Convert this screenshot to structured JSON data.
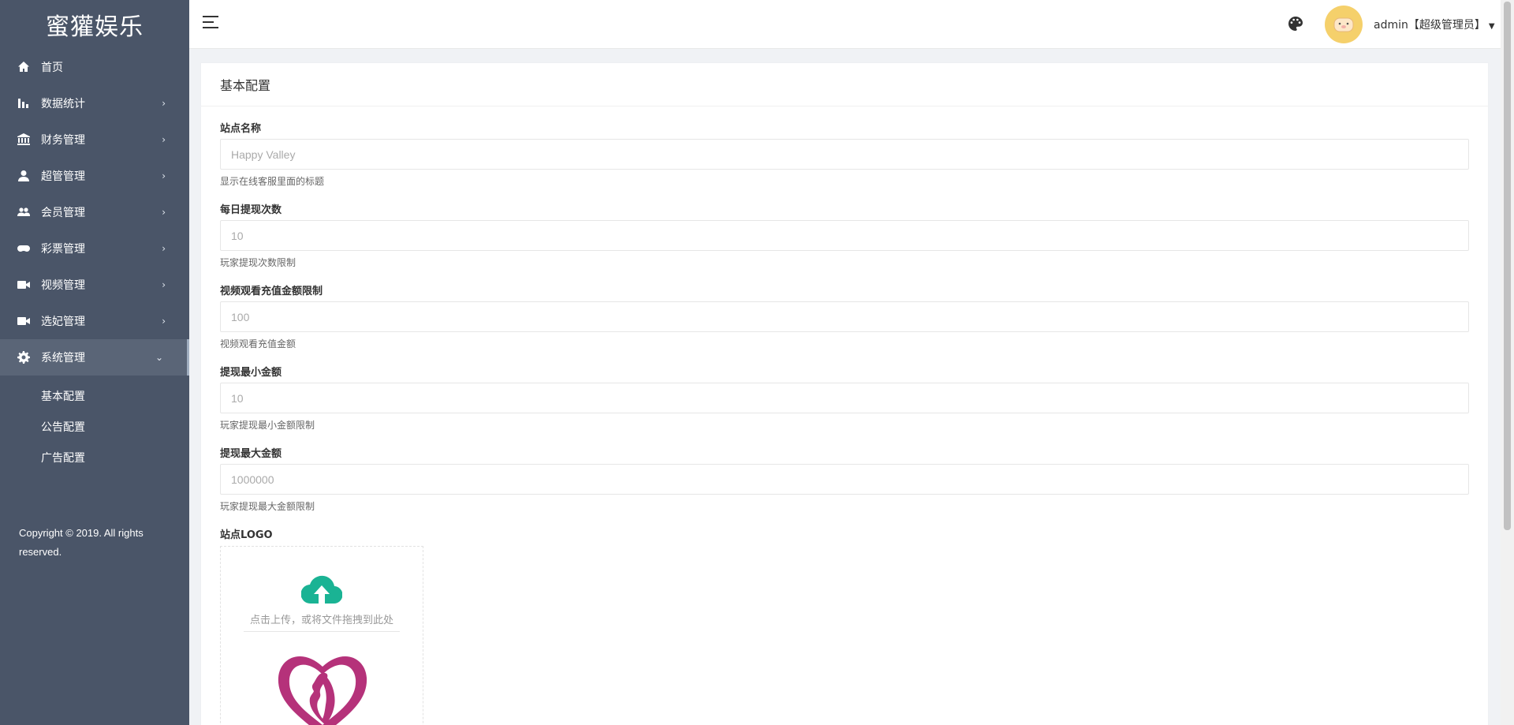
{
  "brand": {
    "title": "蜜獾娱乐"
  },
  "sidebar": {
    "items": [
      {
        "label": "首页",
        "icon": "home-icon",
        "has_children": false
      },
      {
        "label": "数据统计",
        "icon": "bar-chart-icon",
        "has_children": true
      },
      {
        "label": "财务管理",
        "icon": "bank-icon",
        "has_children": true
      },
      {
        "label": "超管管理",
        "icon": "user-icon",
        "has_children": true
      },
      {
        "label": "会员管理",
        "icon": "users-icon",
        "has_children": true
      },
      {
        "label": "彩票管理",
        "icon": "gamepad-icon",
        "has_children": true
      },
      {
        "label": "视频管理",
        "icon": "video-icon",
        "has_children": true
      },
      {
        "label": "选妃管理",
        "icon": "video-icon",
        "has_children": true
      },
      {
        "label": "系统管理",
        "icon": "gear-icon",
        "has_children": true,
        "expanded": true
      }
    ],
    "submenu": [
      "基本配置",
      "公告配置",
      "广告配置"
    ],
    "copyright": "Copyright © 2019. All rights reserved."
  },
  "header": {
    "user_label": "admin【超级管理员】",
    "icons": [
      "hamburger-icon",
      "palette-icon",
      "avatar"
    ]
  },
  "main": {
    "card_title": "基本配置",
    "fields": [
      {
        "label": "站点名称",
        "placeholder": "Happy Valley",
        "hint": "显示在线客服里面的标题"
      },
      {
        "label": "每日提现次数",
        "placeholder": "10",
        "hint": "玩家提现次数限制"
      },
      {
        "label": "视频观看充值金额限制",
        "placeholder": "100",
        "hint": "视频观看充值金额"
      },
      {
        "label": "提现最小金额",
        "placeholder": "10",
        "hint": "玩家提现最小金额限制"
      },
      {
        "label": "提现最大金额",
        "placeholder": "1000000",
        "hint": "玩家提现最大金额限制"
      }
    ],
    "logo_field": {
      "label": "站点LOGO",
      "upload_text": "点击上传，或将文件拖拽到此处"
    }
  },
  "colors": {
    "sidebar_bg": "#4a5568",
    "upload_icon": "#1ab394",
    "logo_primary": "#b5327a"
  }
}
